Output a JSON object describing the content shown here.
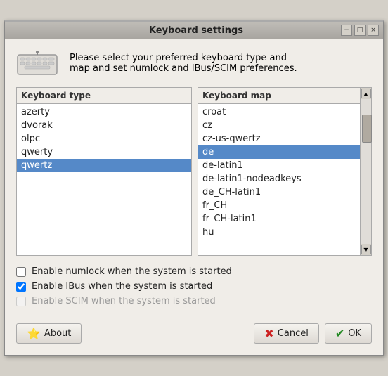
{
  "window": {
    "title": "Keyboard settings",
    "controls": {
      "minimize": "−",
      "maximize": "□",
      "close": "×"
    }
  },
  "description": {
    "text_line1": "Please select your preferred keyboard type and",
    "text_line2": "map and set numlock and IBus/SCIM preferences."
  },
  "keyboard_type": {
    "header": "Keyboard type",
    "items": [
      {
        "label": "azerty",
        "selected": false
      },
      {
        "label": "dvorak",
        "selected": false
      },
      {
        "label": "olpc",
        "selected": false
      },
      {
        "label": "qwerty",
        "selected": false
      },
      {
        "label": "qwertz",
        "selected": true
      }
    ]
  },
  "keyboard_map": {
    "header": "Keyboard map",
    "items": [
      {
        "label": "croat",
        "selected": false
      },
      {
        "label": "cz",
        "selected": false
      },
      {
        "label": "cz-us-qwertz",
        "selected": false
      },
      {
        "label": "de",
        "selected": true
      },
      {
        "label": "de-latin1",
        "selected": false
      },
      {
        "label": "de-latin1-nodeadkeys",
        "selected": false
      },
      {
        "label": "de_CH-latin1",
        "selected": false
      },
      {
        "label": "fr_CH",
        "selected": false
      },
      {
        "label": "fr_CH-latin1",
        "selected": false
      },
      {
        "label": "hu",
        "selected": false
      }
    ]
  },
  "checkboxes": {
    "numlock": {
      "label": "Enable numlock when the system is started",
      "checked": false,
      "enabled": true
    },
    "ibus": {
      "label": "Enable IBus when the system is started",
      "checked": true,
      "enabled": true
    },
    "scim": {
      "label": "Enable SCIM when the system is started",
      "checked": false,
      "enabled": false
    }
  },
  "buttons": {
    "about": "About",
    "cancel": "Cancel",
    "ok": "OK"
  }
}
